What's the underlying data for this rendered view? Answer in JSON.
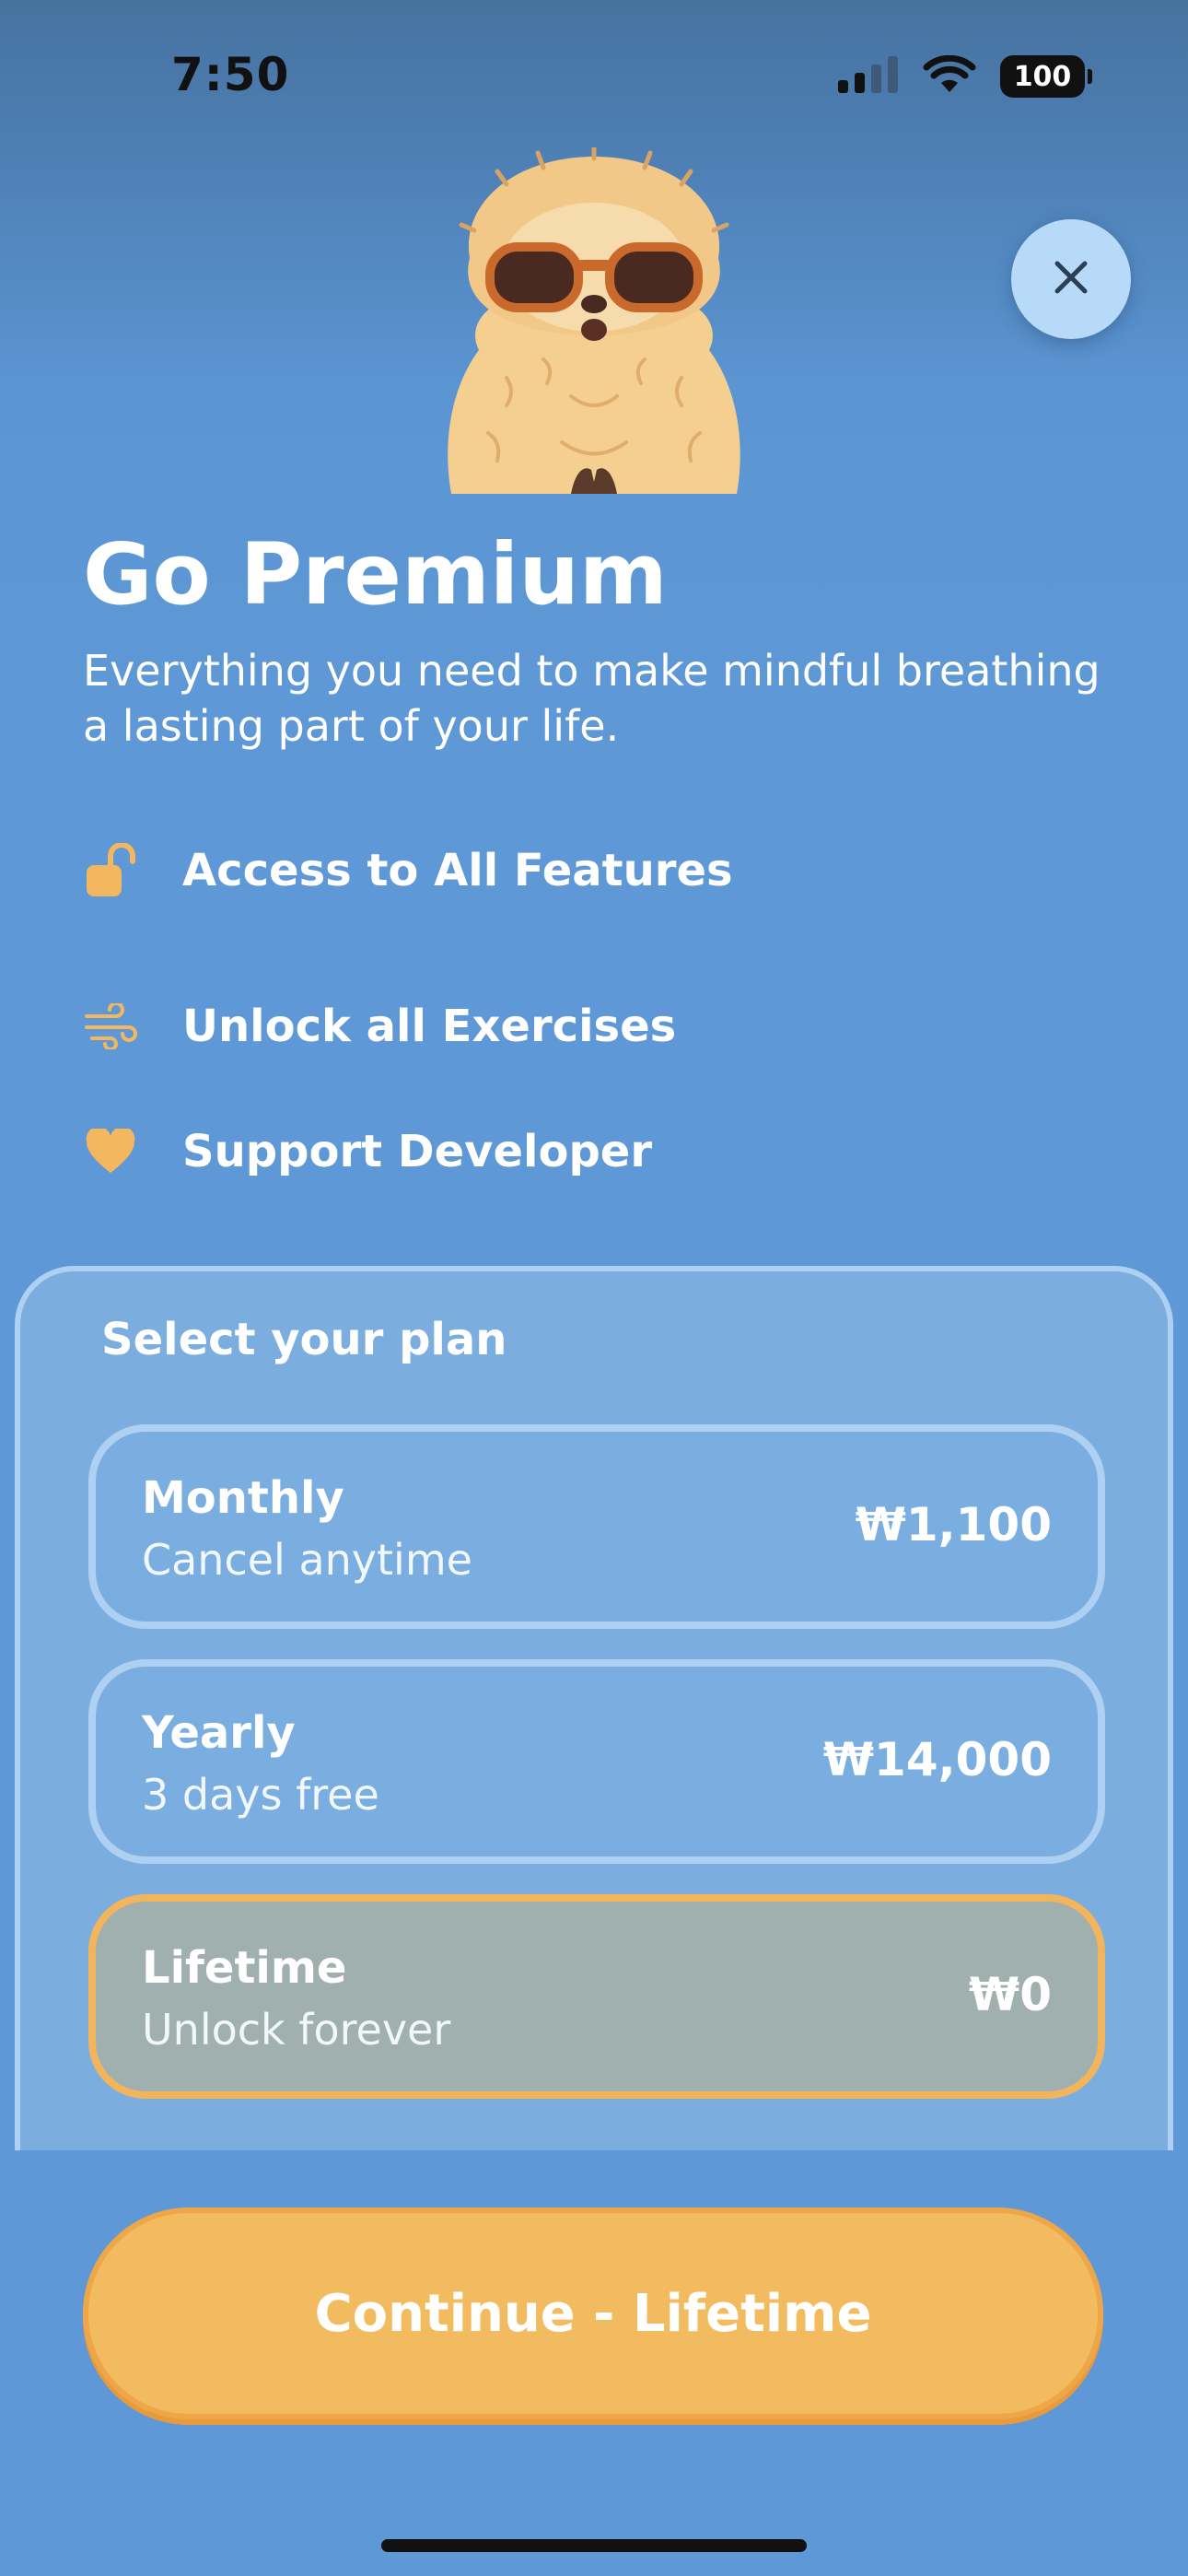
{
  "status_bar": {
    "time": "7:50",
    "battery": "100"
  },
  "hero": {
    "title": "Go Premium",
    "subtitle": "Everything you need to make mindful breathing a lasting part of your life."
  },
  "features": [
    {
      "icon": "unlock-icon",
      "label": "Access to All Features"
    },
    {
      "icon": "wind-icon",
      "label": "Unlock all Exercises"
    },
    {
      "icon": "heart-icon",
      "label": "Support Developer"
    }
  ],
  "plans": {
    "heading": "Select your plan",
    "options": [
      {
        "name": "Monthly",
        "description": "Cancel anytime",
        "price": "₩1,100",
        "selected": false
      },
      {
        "name": "Yearly",
        "description": "3 days free",
        "price": "₩14,000",
        "selected": false
      },
      {
        "name": "Lifetime",
        "description": "Unlock forever",
        "price": "₩0",
        "selected": true
      }
    ]
  },
  "continue_button": {
    "label": "Continue - Lifetime"
  },
  "colors": {
    "background": "#5e98d6",
    "accent": "#f3bb5f",
    "panel": "#7badde",
    "close_button": "#b7daf8"
  }
}
